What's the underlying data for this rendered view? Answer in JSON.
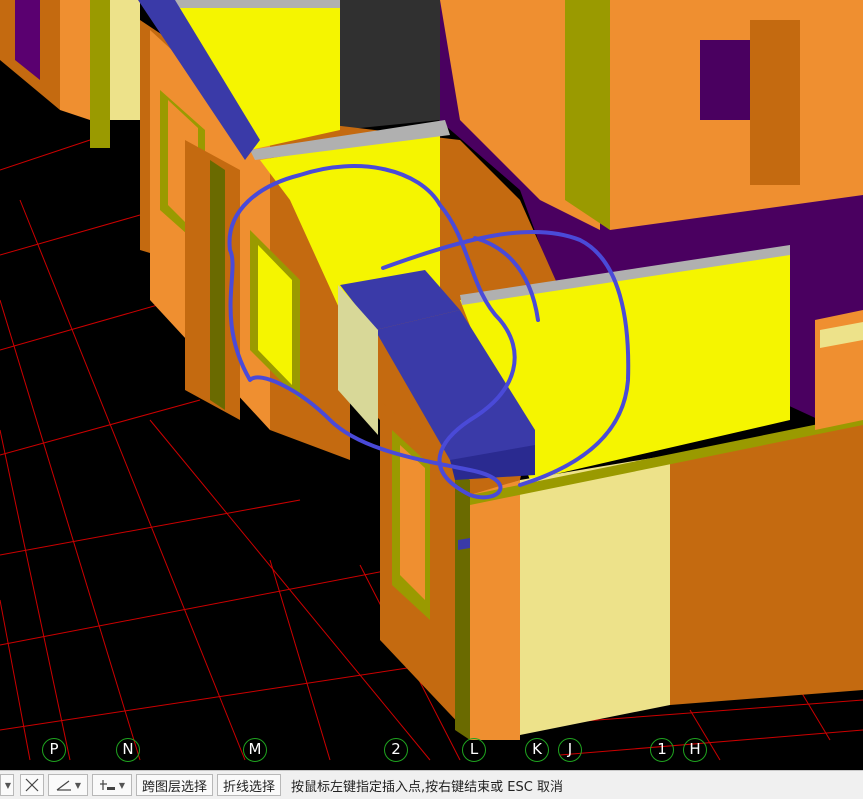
{
  "axes": {
    "bubbles": [
      "P",
      "N",
      "M",
      "2",
      "L",
      "K",
      "J",
      "1",
      "H"
    ]
  },
  "toolbar": {
    "select_mode_icon": "dropdown-caret-icon",
    "cross_icon": "cross-select-icon",
    "angle_icon": "angle-icon",
    "offset_icon": "offset-icon",
    "cross_layer_select_label": "跨图层选择",
    "polyline_select_label": "折线选择"
  },
  "status": {
    "prompt": "按鼠标左键指定插入点,按右键结束或 ESC 取消"
  },
  "colors": {
    "background": "#000000",
    "grid_line": "#cc0000",
    "axis_circle": "#1fa31f",
    "wall_orange": "#ef8f30",
    "wall_dark_orange": "#c46a10",
    "wall_yellow": "#f5f500",
    "wall_olive": "#9a9a00",
    "floor_purple": "#4a0060",
    "beam_blue": "#3a3aa8",
    "highlight_stroke": "#4a4ad8",
    "pale_yellow": "#ede28a"
  }
}
